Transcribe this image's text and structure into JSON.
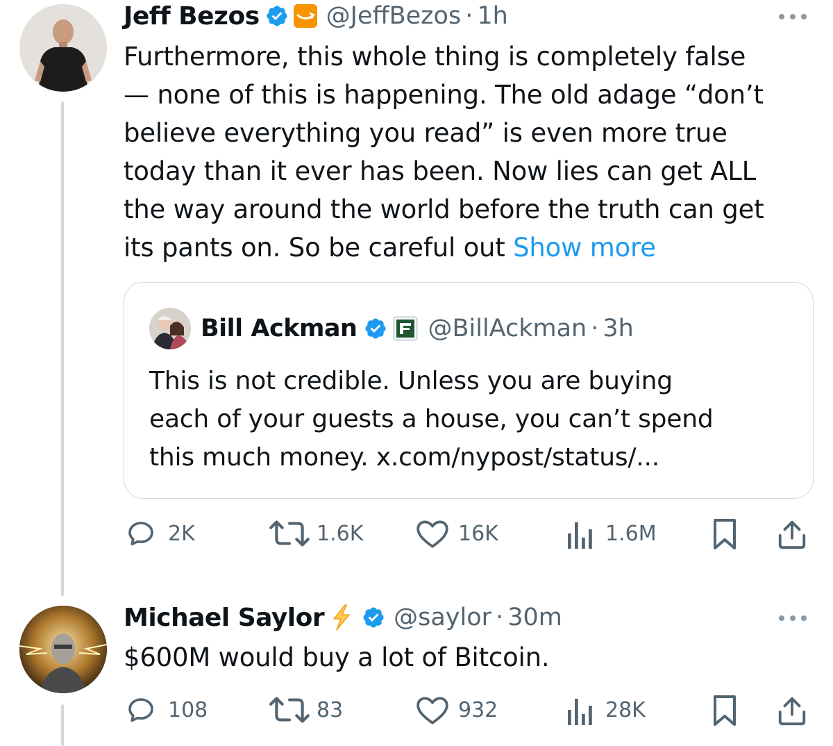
{
  "tweet1": {
    "name": "Jeff Bezos",
    "handle": "@JeffBezos",
    "time": "1h",
    "affiliation_icon": "amazon-smile-logo",
    "verified_color": "#1d9bf0",
    "text_lines": [
      "Furthermore, this whole thing is completely false",
      "— none of this is happening. The old adage “don’t",
      "believe everything you read” is even more true",
      "today than it ever has been. Now lies can get ALL",
      "the way around the world before the truth can get"
    ],
    "last_line_text": "its pants on. So be careful out ",
    "show_more": "Show more",
    "quote": {
      "name": "Bill Ackman",
      "handle": "@BillAckman",
      "time": "3h",
      "affiliation_icon": "pershing-square-logo",
      "text_lines": [
        "This is not credible. Unless you are buying",
        "each of your guests a house, you can’t spend",
        "this much money. x.com/nypost/status/..."
      ]
    },
    "metrics": {
      "replies": "2K",
      "reposts": "1.6K",
      "likes": "16K",
      "views": "1.6M"
    }
  },
  "tweet2": {
    "name": "Michael Saylor",
    "name_emoji": "⚡",
    "handle": "@saylor",
    "time": "30m",
    "text": "$600M would buy a lot of Bitcoin.",
    "metrics": {
      "replies": "108",
      "reposts": "83",
      "likes": "932",
      "views": "28K"
    }
  },
  "separator": "·",
  "colors": {
    "accent": "#1d9bf0",
    "secondary_text": "#536471",
    "border": "#cfd9de",
    "amazon_orange": "#f79400",
    "pershing_green": "#1e5631"
  }
}
